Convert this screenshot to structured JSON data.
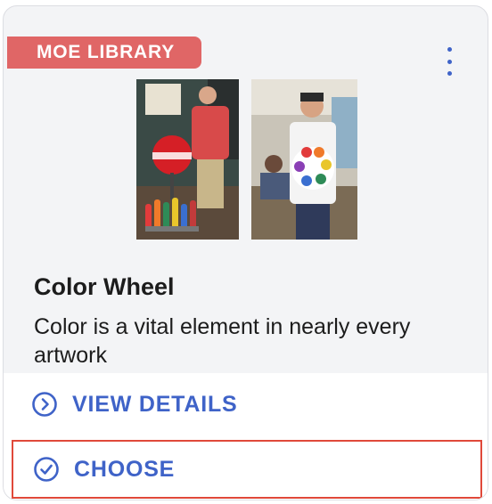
{
  "card": {
    "badge_label": "MOE LIBRARY",
    "title": "Color Wheel",
    "description": "Color is a vital element in nearly every artwork",
    "images": [
      {
        "alt": "Student with Coca-Cola bottle color wheel"
      },
      {
        "alt": "Student wearing color wheel t-shirt"
      }
    ]
  },
  "actions": {
    "view_details_label": "VIEW DETAILS",
    "choose_label": "CHOOSE"
  },
  "colors": {
    "accent": "#3f63c8",
    "badge": "#e06666",
    "focus_outline": "#e0493a",
    "card_bg": "#f3f4f6"
  },
  "icons": {
    "menu": "kebab-vertical-icon",
    "view_details": "chevron-right-circle-icon",
    "choose": "check-circle-icon"
  }
}
